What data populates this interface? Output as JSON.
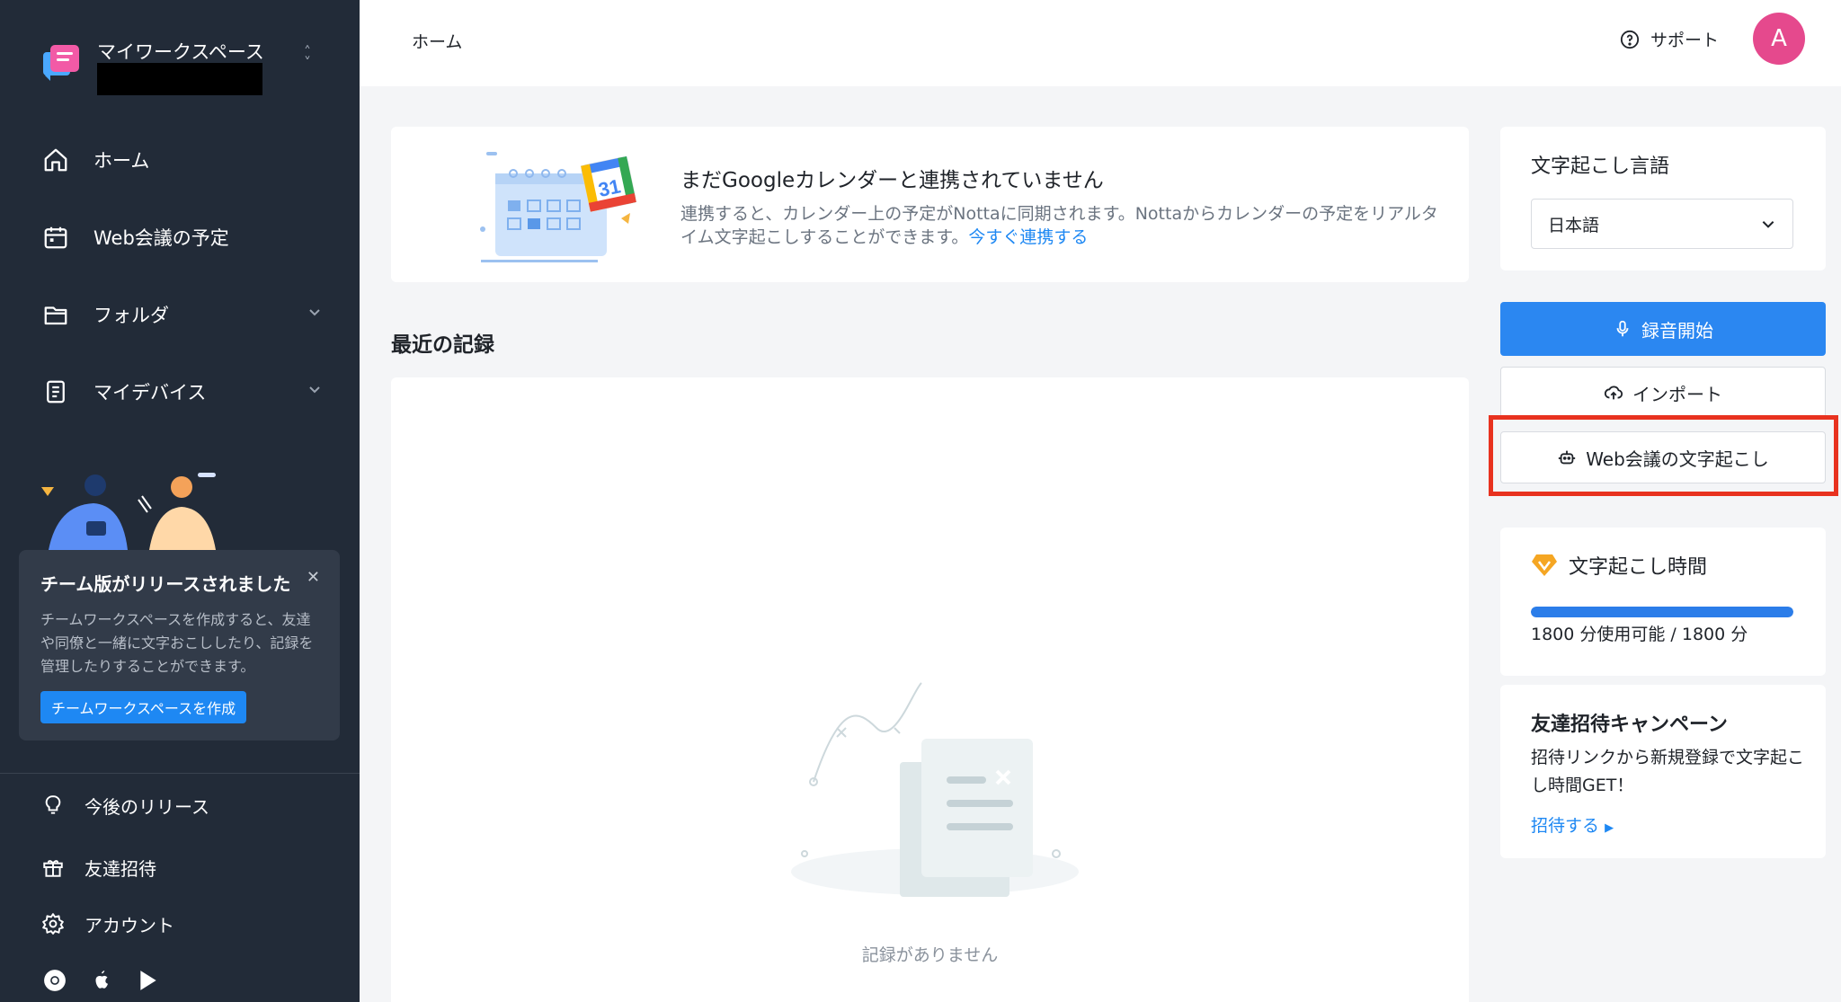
{
  "sidebar": {
    "workspace": {
      "name": "マイワークスペース"
    },
    "nav": [
      {
        "label": "ホーム",
        "icon": "home-icon"
      },
      {
        "label": "Web会議の予定",
        "icon": "calendar-icon"
      },
      {
        "label": "フォルダ",
        "icon": "folder-icon"
      },
      {
        "label": "マイデバイス",
        "icon": "device-icon"
      }
    ],
    "promo": {
      "title": "チーム版がリリースされました",
      "body": "チームワークスペースを作成すると、友達や同僚と一緒に文字おこししたり、記録を管理したりすることができます。",
      "button": "チームワークスペースを作成"
    },
    "bottom": [
      {
        "label": "今後のリリース",
        "icon": "lightbulb-icon"
      },
      {
        "label": "友達招待",
        "icon": "gift-icon"
      },
      {
        "label": "アカウント",
        "icon": "gear-icon"
      }
    ]
  },
  "header": {
    "breadcrumb": "ホーム",
    "support": "サポート",
    "avatar": "A"
  },
  "main": {
    "gcal": {
      "title": "まだGoogleカレンダーと連携されていません",
      "desc": "連携すると、カレンダー上の予定がNottaに同期されます。Nottaからカレンダーの予定をリアルタイム文字起こしすることができます。",
      "link": "今すぐ連携する",
      "badge": "31"
    },
    "recent_title": "最近の記録",
    "empty_text": "記録がありません"
  },
  "right": {
    "lang_title": "文字起こし言語",
    "lang_value": "日本語",
    "record_btn": "録音開始",
    "import_btn": "インポート",
    "meeting_btn": "Web会議の文字起こし",
    "usage_title": "文字起こし時間",
    "usage_text": "1800 分使用可能 / 1800 分",
    "usage_fraction": 1.0,
    "invite_title": "友達招待キャンペーン",
    "invite_desc": "招待リンクから新規登録で文字起こし時間GET！",
    "invite_link": "招待する"
  },
  "colors": {
    "sidebar_bg": "#222b38",
    "accent": "#2b87f1",
    "avatar": "#e5498d",
    "highlight": "#e8321f"
  }
}
